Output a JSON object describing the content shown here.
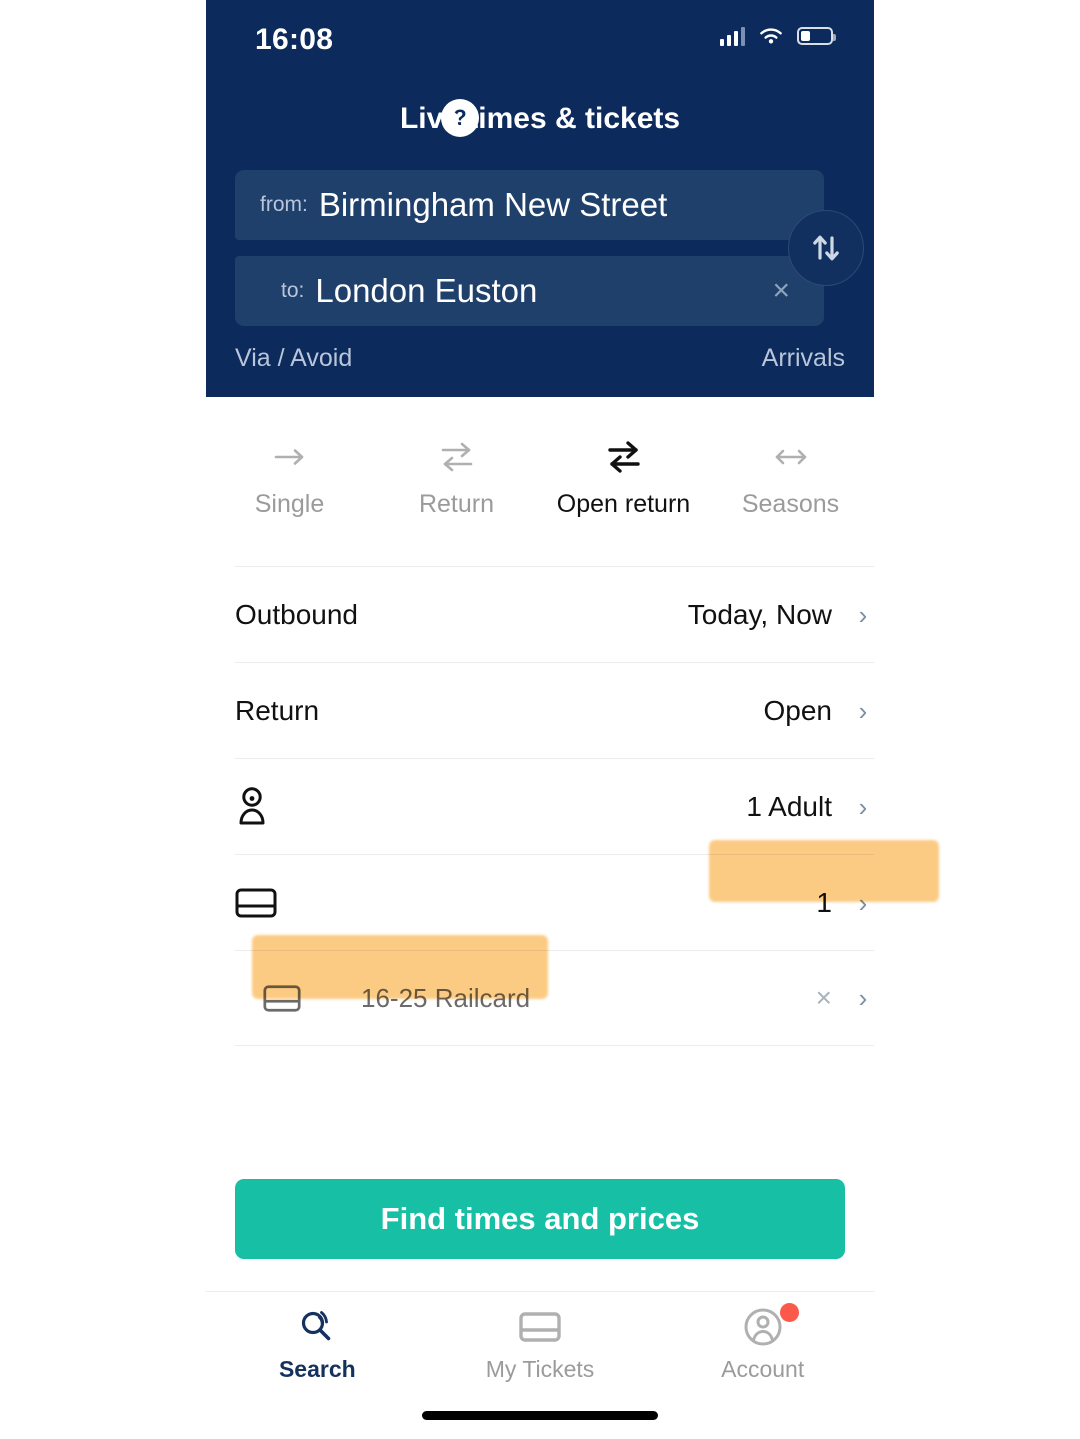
{
  "status_bar": {
    "time": "16:08",
    "signal_icon": "cellular-signal-icon",
    "wifi_icon": "wifi-icon",
    "battery_icon": "battery-low-icon"
  },
  "header": {
    "help_label": "?",
    "title": "Live times & tickets",
    "from": {
      "label": "from:",
      "value": "Birmingham New Street"
    },
    "to": {
      "label": "to:",
      "value": "London Euston",
      "clear_label": "×"
    },
    "swap_icon": "swap-vertical-icon",
    "via_avoid": "Via / Avoid",
    "arrivals": "Arrivals",
    "bg_color": "#0c2a5b",
    "field_bg_color": "#20406c"
  },
  "ticket_tabs": [
    {
      "label": "Single",
      "icon": "arrow-right-icon",
      "active": false
    },
    {
      "label": "Return",
      "icon": "arrows-exchange-icon",
      "active": false
    },
    {
      "label": "Open return",
      "icon": "arrows-open-return-icon",
      "active": true
    },
    {
      "label": "Seasons",
      "icon": "arrows-left-right-icon",
      "active": false
    }
  ],
  "options": {
    "outbound": {
      "label": "Outbound",
      "value": "Today, Now"
    },
    "return": {
      "label": "Return",
      "value": "Open"
    },
    "passengers": {
      "icon": "person-icon",
      "value": "1 Adult"
    },
    "railcards": {
      "icon": "railcard-icon",
      "value": "1"
    },
    "railcard_item": {
      "icon": "railcard-icon",
      "name": "16-25 Railcard",
      "remove_label": "×"
    },
    "chevron": "›"
  },
  "highlights": {
    "color": "#fbc069",
    "targets": [
      "railcard-count",
      "railcard-name"
    ]
  },
  "cta": {
    "label": "Find times and prices",
    "color": "#17bfa5"
  },
  "bottom_nav": [
    {
      "label": "Search",
      "icon": "live-search-icon",
      "active": true,
      "badge": false
    },
    {
      "label": "My Tickets",
      "icon": "ticket-icon",
      "active": false,
      "badge": false
    },
    {
      "label": "Account",
      "icon": "account-avatar-icon",
      "active": false,
      "badge": true
    }
  ]
}
